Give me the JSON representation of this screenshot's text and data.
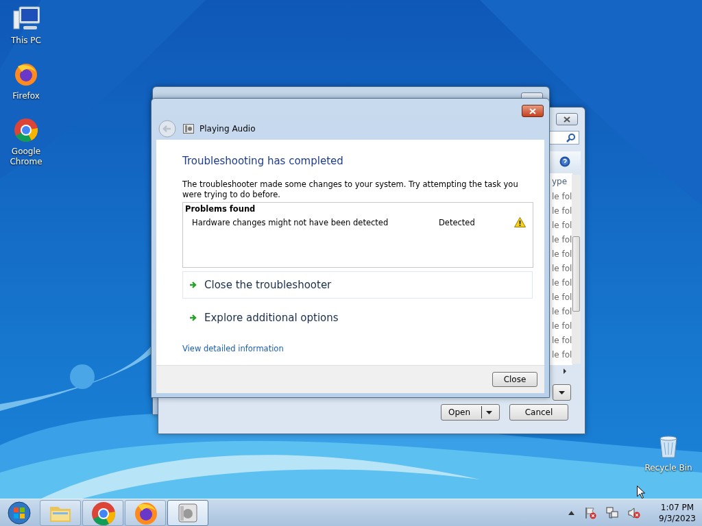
{
  "desktop_icons": [
    {
      "label": "This PC",
      "kind": "computer"
    },
    {
      "label": "Firefox",
      "kind": "firefox"
    },
    {
      "label": "Google Chrome",
      "kind": "chrome"
    }
  ],
  "recycle_bin": {
    "label": "Recycle Bin"
  },
  "file_dialog": {
    "column_header": "ype",
    "rows": [
      "le fol",
      "le fol",
      "le fol",
      "le fol",
      "le fol",
      "le fol",
      "le fol",
      "le fol",
      "le fol",
      "le fol",
      "le fol",
      "le fol"
    ],
    "buttons": [
      {
        "label": "Open",
        "kind": "split"
      },
      {
        "label": "Cancel",
        "kind": "plain"
      }
    ]
  },
  "troubleshooter": {
    "title": "Playing Audio",
    "heading": "Troubleshooting has completed",
    "description": "The troubleshooter made some changes to your system. Try attempting the task you were trying to do before.",
    "problems_header": "Problems found",
    "problems": [
      {
        "name": "Hardware changes might not have been detected",
        "status": "Detected"
      }
    ],
    "options": [
      {
        "label": "Close the troubleshooter",
        "focused": true
      },
      {
        "label": "Explore additional options",
        "focused": false
      }
    ],
    "link": "View detailed information",
    "close_button": "Close"
  },
  "taskbar": {
    "items": [
      {
        "kind": "folder",
        "selected": false
      },
      {
        "kind": "chrome",
        "selected": false
      },
      {
        "kind": "firefox",
        "selected": false
      },
      {
        "kind": "troubleshooter",
        "selected": true
      }
    ],
    "time": "1:07 PM",
    "date": "9/3/2023"
  }
}
